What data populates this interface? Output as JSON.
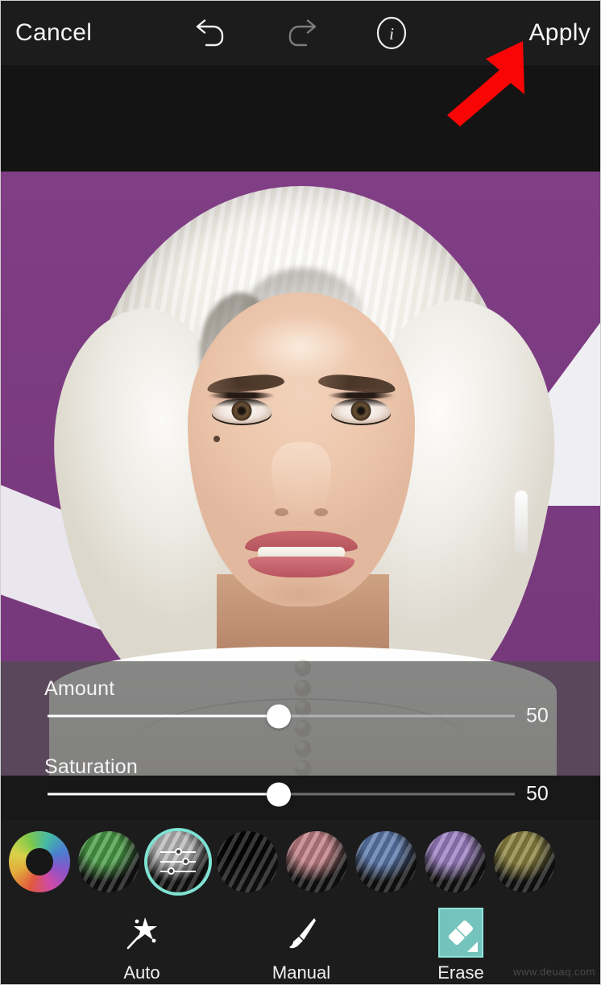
{
  "topbar": {
    "cancel_label": "Cancel",
    "apply_label": "Apply",
    "undo_icon": "undo-arrow-icon",
    "redo_icon": "redo-arrow-icon",
    "info_icon": "info-circle-icon"
  },
  "photo": {
    "description": "Portrait of a woman with platinum blonde hair against a purple backdrop",
    "background_color": "#7B3A80",
    "accent_shape_color": "#efeff3",
    "hair_color": "#f4f1ea",
    "garment_color": "#ffffff"
  },
  "sliders": [
    {
      "label": "Amount",
      "value": "50",
      "percent": 49.5
    },
    {
      "label": "Saturation",
      "value": "50",
      "percent": 49.5
    }
  ],
  "swatches": [
    {
      "name": "color-wheel",
      "label": "Color Wheel",
      "type": "wheel",
      "color": "#e0593f",
      "selected": false
    },
    {
      "name": "green",
      "label": "Green",
      "type": "hair",
      "color": "#4a9c46",
      "selected": false
    },
    {
      "name": "silver-custom",
      "label": "Silver Custom",
      "type": "sliders",
      "color": "#b9b9b9",
      "selected": true
    },
    {
      "name": "black",
      "label": "Black",
      "type": "hair",
      "color": "#050505",
      "selected": false
    },
    {
      "name": "rose",
      "label": "Rose",
      "type": "hair",
      "color": "#c07f84",
      "selected": false
    },
    {
      "name": "blue",
      "label": "Blue",
      "type": "hair",
      "color": "#5b79ac",
      "selected": false
    },
    {
      "name": "purple",
      "label": "Purple",
      "type": "hair",
      "color": "#9b7ec2",
      "selected": false
    },
    {
      "name": "olive",
      "label": "Olive",
      "type": "hair",
      "color": "#8d8340",
      "selected": false
    }
  ],
  "tools": [
    {
      "label": "Auto",
      "icon": "magic-wand-icon",
      "active": false
    },
    {
      "label": "Manual",
      "icon": "paintbrush-icon",
      "active": false
    },
    {
      "label": "Erase",
      "icon": "eraser-icon",
      "active": true
    }
  ],
  "annotation": {
    "arrow_color": "#f90505",
    "points_to": "Apply"
  },
  "watermark": {
    "text": "www.deuaq.com"
  },
  "theme": {
    "bar_background": "#1c1c1c",
    "panel_background": "#181818",
    "accent": "#7fe3d4",
    "text": "#f2f2f2"
  }
}
